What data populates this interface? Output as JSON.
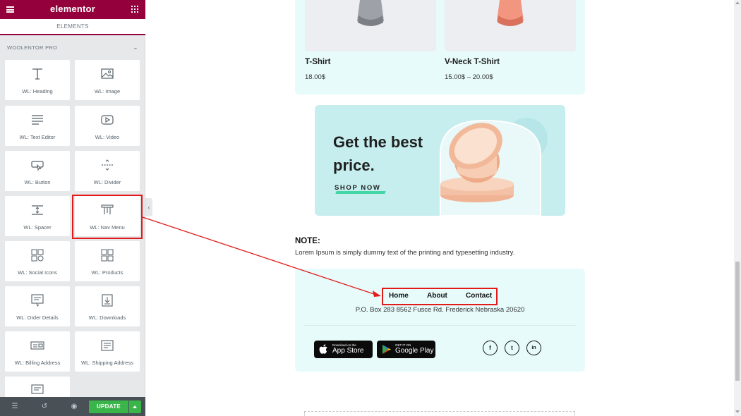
{
  "editor": {
    "logo": "elementor",
    "tab_elements": "ELEMENTS",
    "section_title": "WOOLENTOR PRO",
    "widgets": [
      {
        "label": "WL: Heading",
        "icon": "heading-icon"
      },
      {
        "label": "WL: Image",
        "icon": "image-icon"
      },
      {
        "label": "WL: Text Editor",
        "icon": "text-editor-icon"
      },
      {
        "label": "WL: Video",
        "icon": "video-icon"
      },
      {
        "label": "WL: Button",
        "icon": "button-icon"
      },
      {
        "label": "WL: Divider",
        "icon": "divider-icon"
      },
      {
        "label": "WL: Spacer",
        "icon": "spacer-icon"
      },
      {
        "label": "WL: Nav Menu",
        "icon": "nav-menu-icon"
      },
      {
        "label": "WL: Social Icons",
        "icon": "social-icons-icon"
      },
      {
        "label": "WL: Products",
        "icon": "products-icon"
      },
      {
        "label": "WL: Order Details",
        "icon": "order-details-icon"
      },
      {
        "label": "WL: Downloads",
        "icon": "downloads-icon"
      },
      {
        "label": "WL: Billing Address",
        "icon": "billing-address-icon"
      },
      {
        "label": "WL: Shipping Address",
        "icon": "shipping-address-icon"
      }
    ],
    "update_label": "UPDATE"
  },
  "products": [
    {
      "name": "T-Shirt",
      "price": "18.00$"
    },
    {
      "name": "V-Neck T-Shirt",
      "price": "15.00$ – 20.00$"
    }
  ],
  "banner": {
    "title": "Get the best price.",
    "cta": "SHOP NOW"
  },
  "note": {
    "title": "NOTE:",
    "text": "Lorem Ipsum is simply dummy text of the printing and typesetting industry."
  },
  "footer": {
    "nav": [
      "Home",
      "About",
      "Contact"
    ],
    "address": "P.O. Box 283 8562 Fusce Rd. Frederick Nebraska 20620",
    "app_store": {
      "small": "Download on the",
      "big": "App Store"
    },
    "google_play": {
      "small": "GET IT ON",
      "big": "Google Play"
    },
    "social": [
      "f",
      "t",
      "in"
    ]
  },
  "colors": {
    "brand": "#93003c",
    "update_green": "#39b54a",
    "highlight_red": "#e21a1a",
    "section_bg": "#e7fbfb",
    "banner_bg": "#c6eeee"
  }
}
